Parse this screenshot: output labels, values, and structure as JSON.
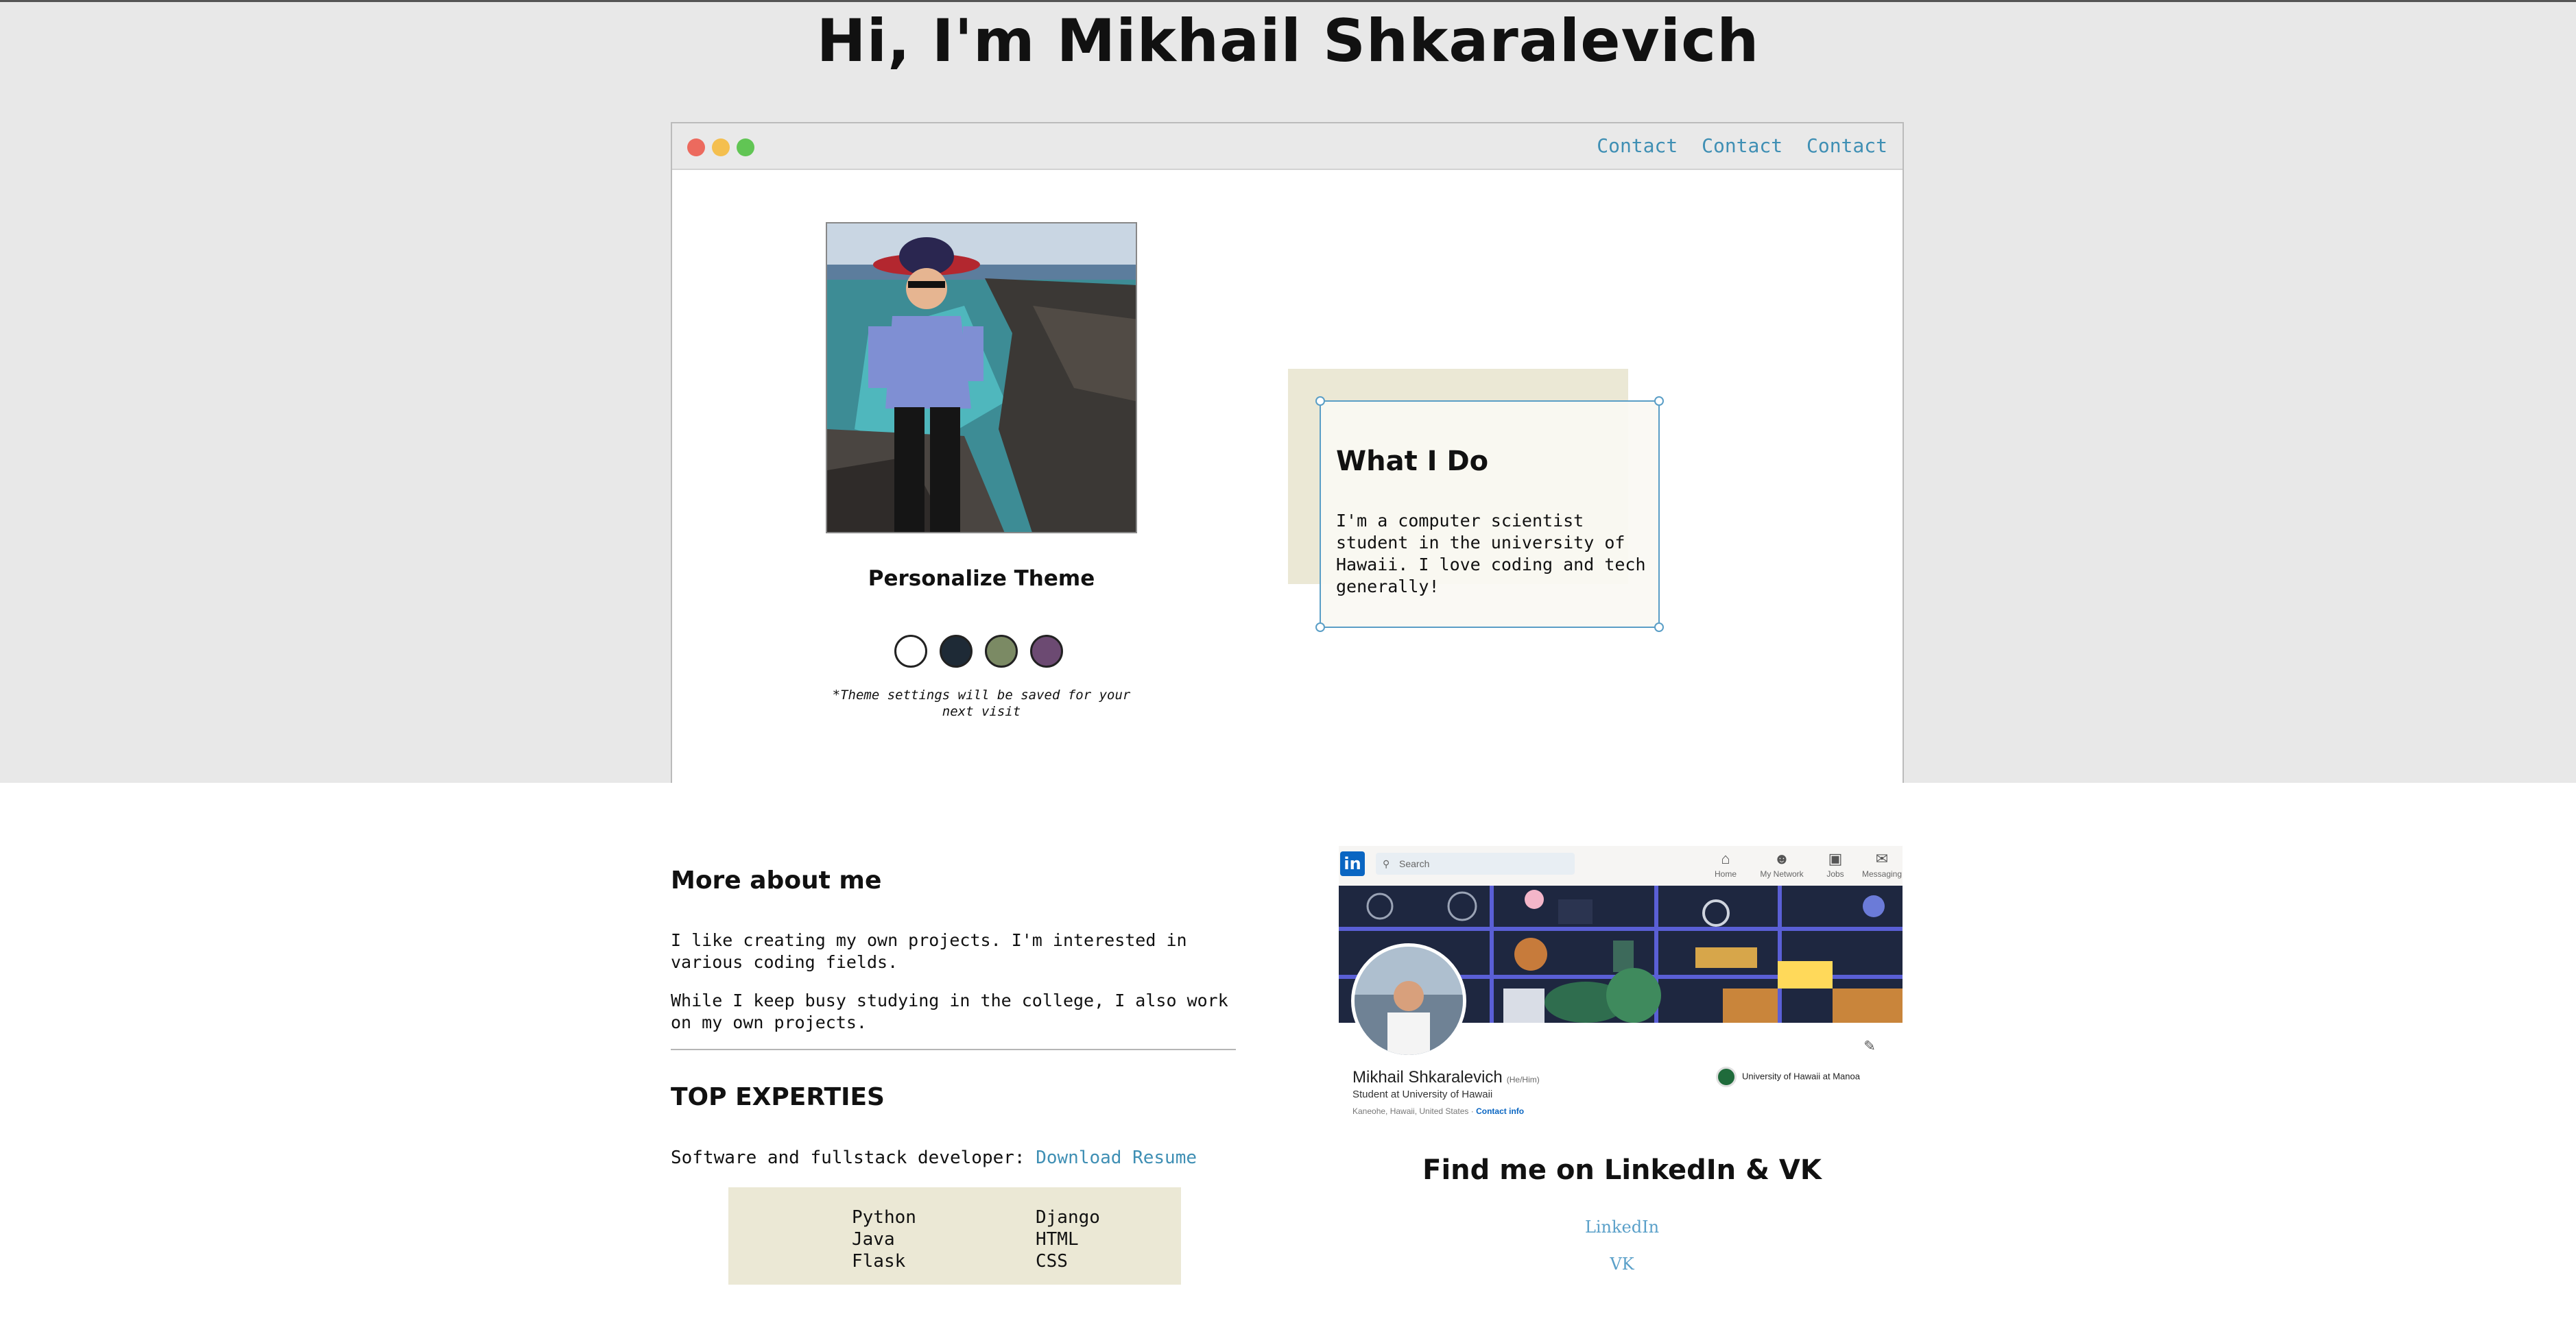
{
  "header": {
    "title": "Hi, I'm Mikhail Shkaralevich"
  },
  "browser": {
    "nav_links": [
      "Contact",
      "Contact",
      "Contact"
    ]
  },
  "theme": {
    "title": "Personalize Theme",
    "swatch_colors": [
      "#ffffff",
      "#1e2a36",
      "#7b8a64",
      "#6c4a72"
    ],
    "note": "*Theme settings will be saved for your next visit"
  },
  "what_i_do": {
    "title": "What I Do",
    "text": "I'm a computer scientist student in the university of Hawaii. I love coding and tech generally!"
  },
  "more_about": {
    "title": "More about me",
    "paragraphs": [
      "I like creating my own projects. I'm interested in various coding fields.",
      "While I keep busy studying in the college, I also work on my own projects."
    ]
  },
  "expertise": {
    "title": "TOP EXPERTIES",
    "resume_prefix": "Software and fullstack developer:",
    "resume_link": "Download Resume",
    "skills_col1": [
      "Python",
      "Java",
      "Flask"
    ],
    "skills_col2": [
      "Django",
      "HTML",
      "CSS"
    ]
  },
  "linkedin_card": {
    "logo": "in",
    "search_placeholder": "Search",
    "nav": [
      "Home",
      "My Network",
      "Jobs",
      "Messaging"
    ],
    "name": "Mikhail Shkaralevich",
    "pronouns": "(He/Him)",
    "headline": "Student at University of Hawaii",
    "location": "Kaneohe, Hawaii, United States ·",
    "contact_info": "Contact info",
    "university": "University of Hawaii at Manoa"
  },
  "social": {
    "title": "Find me on LinkedIn & VK",
    "links": [
      "LinkedIn",
      "VK"
    ]
  },
  "colors": {
    "accent_link": "#3f8fb4",
    "card_border": "#5a9ec6",
    "card_bg": "#ebe8d5",
    "linkedin_blue": "#0a66c2"
  }
}
